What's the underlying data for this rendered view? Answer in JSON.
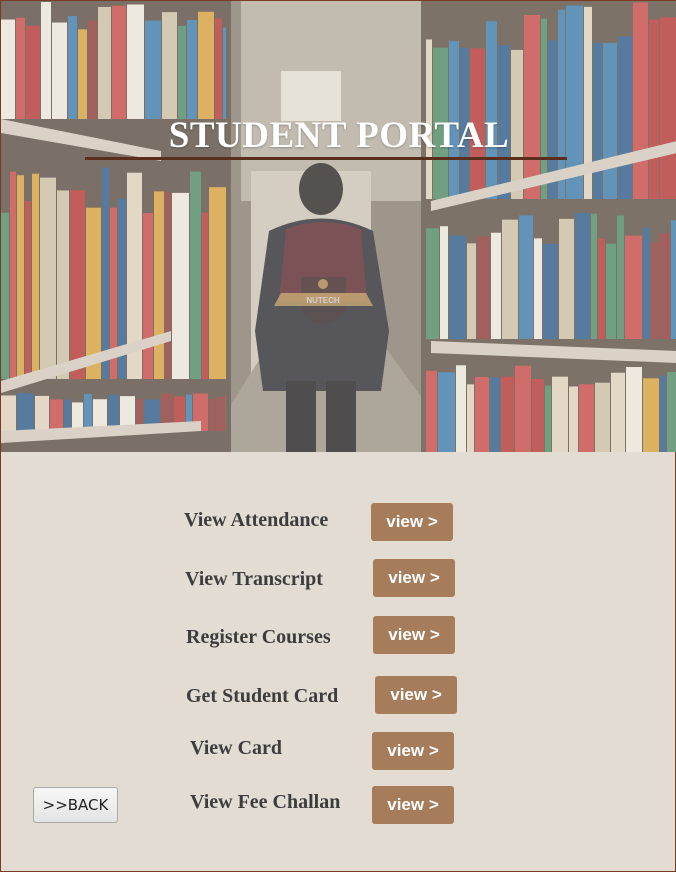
{
  "header": {
    "title": "STUDENT PORTAL",
    "logo_text": "NUTECH"
  },
  "options": [
    {
      "label": "View Attendance",
      "button": "view >"
    },
    {
      "label": "View Transcript",
      "button": "view >"
    },
    {
      "label": "Register Courses",
      "button": "view >"
    },
    {
      "label": "Get Student Card",
      "button": "view >"
    },
    {
      "label": "View Card",
      "button": "view >"
    },
    {
      "label": "View Fee Challan",
      "button": "view >"
    }
  ],
  "back_button": ">>BACK",
  "colors": {
    "background": "#e2dcd3",
    "button": "#a67c5b",
    "title_rule": "#5a2e1c",
    "label_text": "#3d3d3d"
  }
}
